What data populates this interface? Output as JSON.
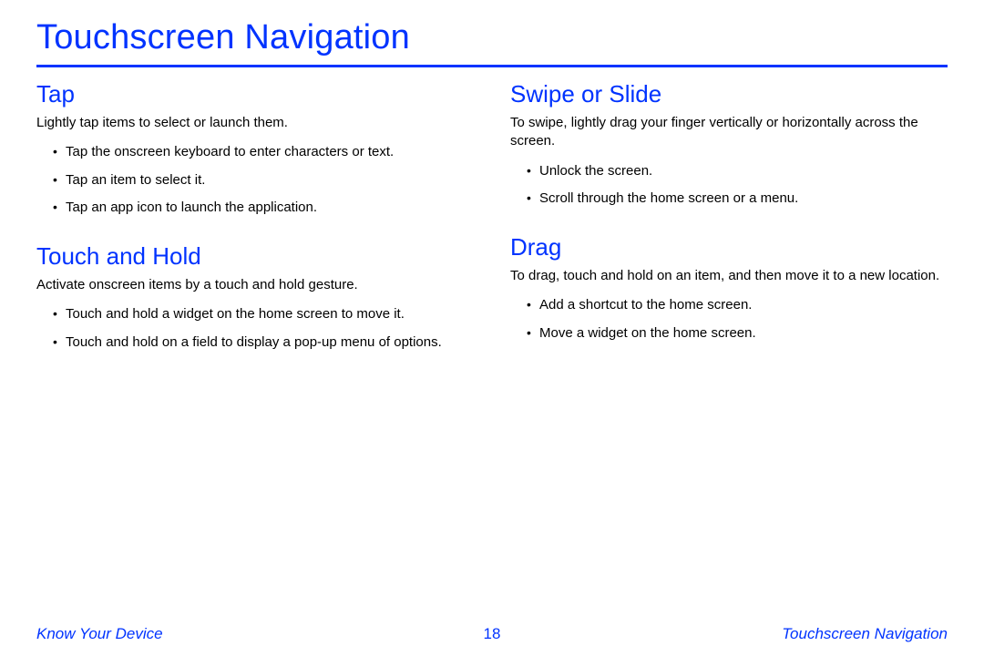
{
  "page_title": "Touchscreen Navigation",
  "left": {
    "sections": [
      {
        "title": "Tap",
        "intro": "Lightly tap items to select or launch them.",
        "bullets": [
          "Tap the onscreen keyboard to enter characters or text.",
          "Tap an item to select it.",
          "Tap an app icon to launch the application."
        ]
      },
      {
        "title": "Touch and Hold",
        "intro": "Activate onscreen items by a touch and hold gesture.",
        "bullets": [
          "Touch and hold a widget on the home screen to move it.",
          "Touch and hold on a field to display a pop-up menu of options."
        ]
      }
    ]
  },
  "right": {
    "sections": [
      {
        "title": "Swipe or Slide",
        "intro": "To swipe, lightly drag your finger vertically or horizontally across the screen.",
        "bullets": [
          "Unlock the screen.",
          "Scroll through the home screen or a menu."
        ]
      },
      {
        "title": "Drag",
        "intro": "To drag, touch and hold on an item, and then move it to a new location.",
        "bullets": [
          "Add a shortcut to the home screen.",
          "Move a widget on the home screen."
        ]
      }
    ]
  },
  "footer": {
    "left": "Know Your Device",
    "center": "18",
    "right": "Touchscreen Navigation"
  }
}
